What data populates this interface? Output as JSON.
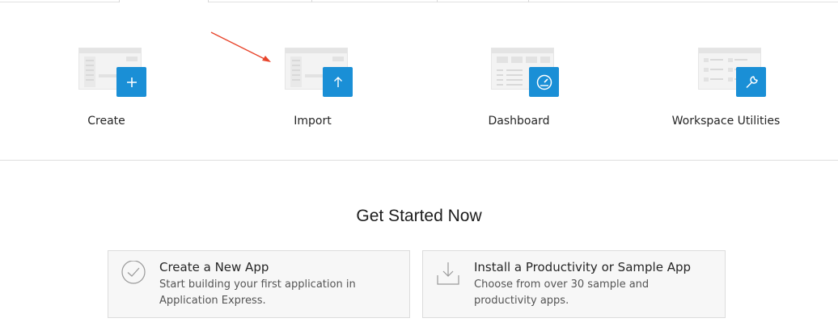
{
  "tiles": [
    {
      "label": "Create",
      "icon": "plus-icon"
    },
    {
      "label": "Import",
      "icon": "upload-arrow-icon"
    },
    {
      "label": "Dashboard",
      "icon": "speedometer-icon"
    },
    {
      "label": "Workspace Utilities",
      "icon": "wrench-icon"
    }
  ],
  "get_started": {
    "heading": "Get Started Now",
    "cards": [
      {
        "title": "Create a New App",
        "description": "Start building your first application in Application Express.",
        "icon": "check-circle-icon"
      },
      {
        "title": "Install a Productivity or Sample App",
        "description": "Choose from over 30 sample and productivity apps.",
        "icon": "download-tray-icon"
      }
    ]
  },
  "colors": {
    "accent": "#1a8fd6",
    "annotation_arrow": "#e8452c"
  }
}
